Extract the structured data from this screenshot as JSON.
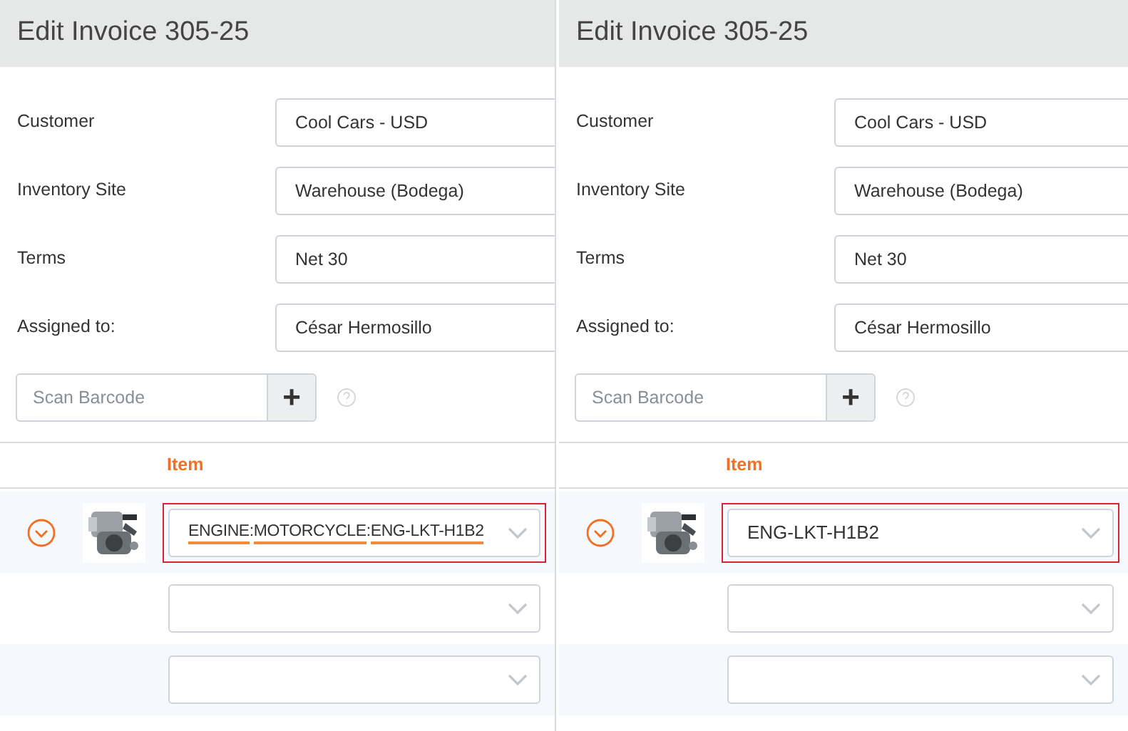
{
  "panels": [
    {
      "title": "Edit Invoice 305-25",
      "fields": [
        {
          "label": "Customer",
          "value": "Cool Cars - USD"
        },
        {
          "label": "Inventory Site",
          "value": "Warehouse (Bodega)"
        },
        {
          "label": "Terms",
          "value": "Net 30"
        },
        {
          "label": "Assigned to:",
          "value": "César Hermosillo"
        }
      ],
      "barcode": {
        "placeholder": "Scan Barcode",
        "button": "+"
      },
      "column_header": "Item",
      "rows": [
        {
          "kind": "item",
          "highlighted": true,
          "segments": [
            {
              "text": "ENGINE",
              "underlined": true
            },
            {
              "text": ":",
              "underlined": false
            },
            {
              "text": "MOTORCYCLE",
              "underlined": true
            },
            {
              "text": ":",
              "underlined": false
            },
            {
              "text": "ENG-LKT-H1B2",
              "underlined": true
            }
          ]
        },
        {
          "kind": "empty"
        },
        {
          "kind": "empty"
        }
      ]
    },
    {
      "title": "Edit Invoice 305-25",
      "fields": [
        {
          "label": "Customer",
          "value": "Cool Cars - USD"
        },
        {
          "label": "Inventory Site",
          "value": "Warehouse (Bodega)"
        },
        {
          "label": "Terms",
          "value": "Net 30"
        },
        {
          "label": "Assigned to:",
          "value": "César Hermosillo"
        }
      ],
      "barcode": {
        "placeholder": "Scan Barcode",
        "button": "+"
      },
      "column_header": "Item",
      "rows": [
        {
          "kind": "item",
          "highlighted": true,
          "segments": [
            {
              "text": "ENG-LKT-H1B2",
              "underlined": false
            }
          ]
        },
        {
          "kind": "empty"
        },
        {
          "kind": "empty"
        }
      ]
    }
  ]
}
